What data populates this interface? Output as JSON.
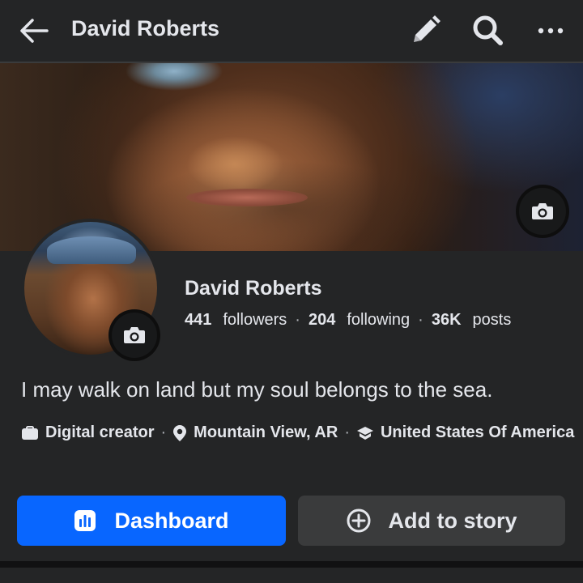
{
  "header": {
    "title": "David Roberts",
    "back_icon": "arrow-left-icon",
    "edit_icon": "pencil-icon",
    "search_icon": "search-icon",
    "more_icon": "more-horizontal-icon"
  },
  "cover": {
    "camera_icon": "camera-icon"
  },
  "profile": {
    "name": "David Roberts",
    "followers_count": "441",
    "followers_label": "followers",
    "following_count": "204",
    "following_label": "following",
    "posts_count": "36K",
    "posts_label": "posts",
    "separator": "·",
    "bio": "I may walk on land but my soul belongs to the sea.",
    "details": [
      {
        "icon": "briefcase-icon",
        "text": "Digital creator"
      },
      {
        "icon": "location-pin-icon",
        "text": "Mountain View, AR"
      },
      {
        "icon": "graduation-cap-icon",
        "text": "United States Of America"
      }
    ]
  },
  "actions": {
    "dashboard_label": "Dashboard",
    "dashboard_icon": "bar-chart-icon",
    "story_label": "Add to story",
    "story_icon": "plus-circle-icon"
  },
  "colors": {
    "background": "#242526",
    "primary_button": "#0866ff",
    "secondary_button": "#3a3b3c",
    "text": "#e4e6eb"
  }
}
